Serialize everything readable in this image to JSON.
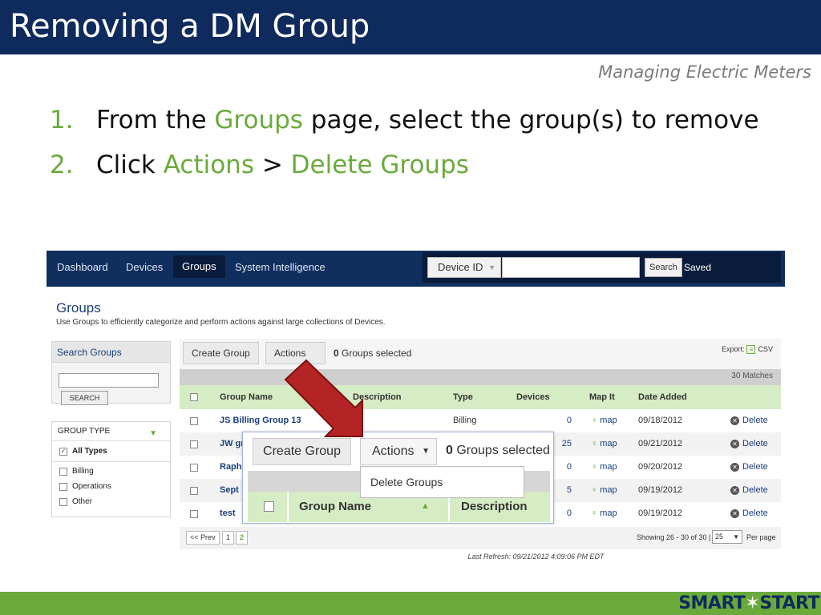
{
  "slide": {
    "title": "Removing a DM Group",
    "subtitle": "Managing Electric Meters",
    "steps": [
      {
        "num": "1.",
        "pre": "From the ",
        "hl": "Groups",
        "post": " page, select the group(s) to remove"
      },
      {
        "num": "2.",
        "pre": "Click ",
        "hl": "Actions",
        "mid": " > ",
        "hl2": "Delete Groups"
      }
    ],
    "logo_left": "SMART",
    "logo_right": "START",
    "accent_color": "#6aaa3a",
    "header_color": "#0f2a5c"
  },
  "app": {
    "nav": [
      "Dashboard",
      "Devices",
      "Groups",
      "System Intelligence"
    ],
    "active_nav": "Groups",
    "search": {
      "selector": "Device ID",
      "button": "Search",
      "saved": "Saved"
    },
    "page_title": "Groups",
    "page_desc": "Use Groups to efficiently categorize and perform actions against large collections of Devices.",
    "search_groups": {
      "title": "Search Groups",
      "button": "SEARCH"
    },
    "group_type": {
      "title": "GROUP TYPE",
      "options": [
        "All Types",
        "Billing",
        "Operations",
        "Other"
      ],
      "checked": "All Types"
    },
    "toolbar": {
      "create": "Create Group",
      "actions": "Actions",
      "selected_count": "0",
      "selected_label": " Groups selected",
      "export_label": "Export:",
      "csv": "CSV"
    },
    "matches": "30 Matches",
    "columns": [
      "Group Name",
      "Description",
      "Type",
      "Devices",
      "Map It",
      "Date Added"
    ],
    "rows": [
      {
        "name": "JS Billing Group 13",
        "type": "Billing",
        "devices": "0",
        "map": "map",
        "date": "09/18/2012",
        "delete": "Delete"
      },
      {
        "name": "JW gr",
        "type": "",
        "devices": "25",
        "map": "map",
        "date": "09/21/2012",
        "delete": "Delete"
      },
      {
        "name": "Raph",
        "type": "",
        "devices": "0",
        "map": "map",
        "date": "09/20/2012",
        "delete": "Delete"
      },
      {
        "name": "Sept",
        "type": "",
        "devices": "5",
        "map": "map",
        "date": "09/19/2012",
        "delete": "Delete"
      },
      {
        "name": "test",
        "type": "",
        "devices": "0",
        "map": "map",
        "date": "09/19/2012",
        "delete": "Delete"
      }
    ],
    "pager": {
      "prev": "<< Prev",
      "pages": [
        "1",
        "2"
      ],
      "current": "2",
      "showing": "Showing 26 - 30 of 30 |",
      "per_page_value": "25",
      "per_page_label": "Per page"
    },
    "refresh": "Last Refresh: 09/21/2012 4:09:06 PM  EDT",
    "zoom": {
      "create": "Create Group",
      "actions": "Actions",
      "count": "0",
      "label": " Groups selected",
      "menu_item": "Delete Groups",
      "col1": "Group Name",
      "col2": "Description"
    }
  }
}
